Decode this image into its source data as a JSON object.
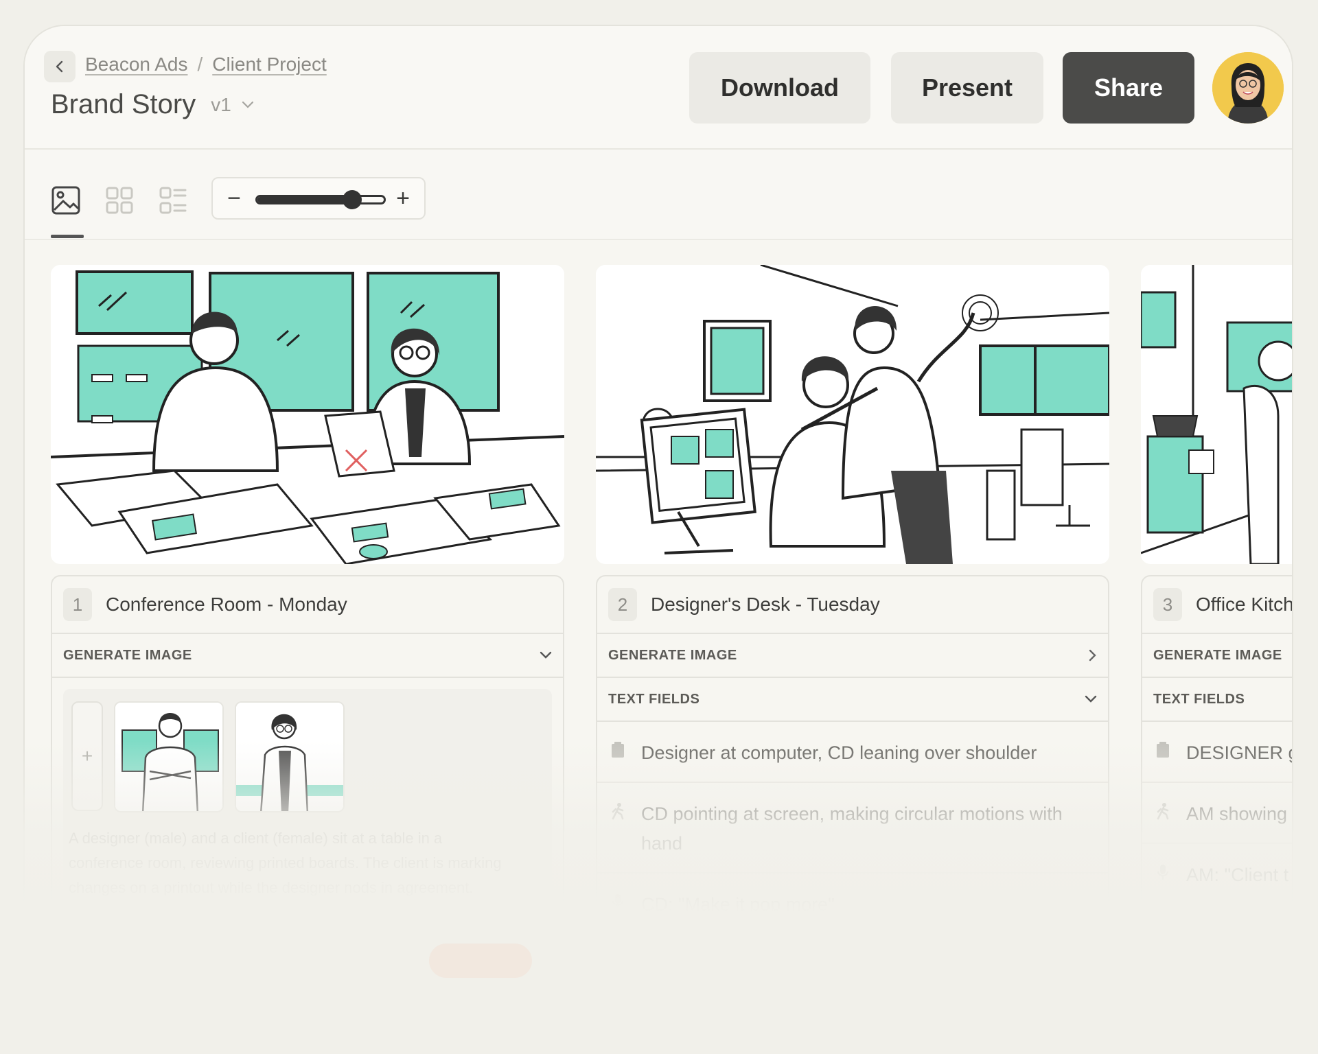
{
  "header": {
    "breadcrumb": [
      "Beacon Ads",
      "Client Project"
    ],
    "breadcrumb_sep": "/",
    "title": "Brand Story",
    "version": "v1",
    "download_label": "Download",
    "present_label": "Present",
    "share_label": "Share"
  },
  "toolbar": {
    "views": [
      "image-view-icon",
      "grid-view-icon",
      "list-view-icon"
    ],
    "active_view": "image-view-icon",
    "zoom_minus": "−",
    "zoom_plus": "+",
    "zoom_level": 0.75
  },
  "scenes": [
    {
      "number": "1",
      "title": "Conference Room - Monday",
      "generate_label": "GENERATE IMAGE",
      "generate_expanded": true,
      "add_ref": "+",
      "description": "A designer (male) and a client (female) sit at a table in a conference room, reviewing printed boards. The client is marking changes on a printout while the designer nods in agreement."
    },
    {
      "number": "2",
      "title": "Designer's Desk - Tuesday",
      "generate_label": "GENERATE IMAGE",
      "text_fields_label": "TEXT FIELDS",
      "fields": [
        "Designer at computer, CD leaning over shoulder",
        "CD pointing at screen, making circular motions with hand",
        "CD: \"Make it pop more\""
      ]
    },
    {
      "number": "3",
      "title": "Office Kitch",
      "generate_label": "GENERATE IMAGE",
      "text_fields_label": "TEXT FIELDS",
      "fields": [
        "DESIGNER g",
        "AM showing",
        "AM: \"Client t"
      ]
    }
  ],
  "colors": {
    "accent_mint": "#7fdcc6",
    "share_bg": "#4b4b49",
    "background": "#f1f0ea"
  }
}
